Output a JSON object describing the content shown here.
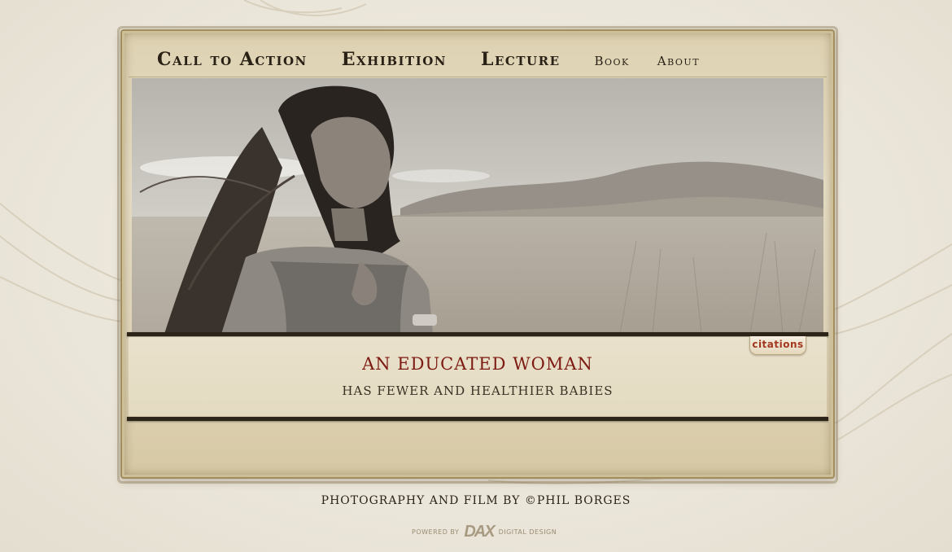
{
  "nav": {
    "items": [
      {
        "label": "Call to Action"
      },
      {
        "label": "Exhibition"
      },
      {
        "label": "Lecture"
      },
      {
        "label": "Book"
      },
      {
        "label": "About"
      }
    ]
  },
  "feature": {
    "headline": "AN EDUCATED WOMAN",
    "subline": "HAS FEWER AND HEALTHIER BABIES",
    "citations_label": "citations"
  },
  "footer": {
    "credit": "PHOTOGRAPHY AND FILM BY ©PHIL BORGES",
    "powered_by": "POWERED BY",
    "logo_text": "DAX",
    "digital_design": "DIGITAL DESIGN"
  },
  "colors": {
    "headline": "#7d1a12",
    "citations": "#a2381f",
    "paper": "#e8dfc7"
  }
}
